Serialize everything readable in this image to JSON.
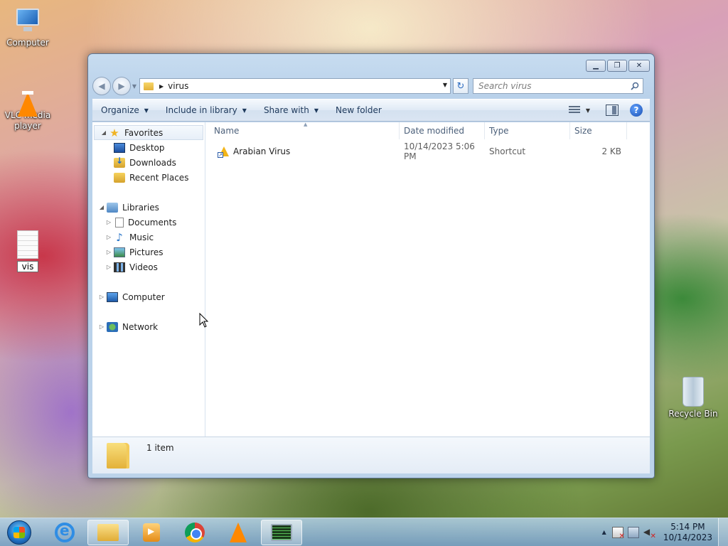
{
  "desktop": {
    "icons": [
      {
        "label": "Computer",
        "icon": "computer-icon"
      },
      {
        "label": "VLC media player",
        "icon": "vlc-icon"
      },
      {
        "label": "vis",
        "icon": "text-file-icon"
      },
      {
        "label": "Recycle Bin",
        "icon": "recycle-bin-icon"
      }
    ]
  },
  "window": {
    "address": {
      "path": "virus"
    },
    "search": {
      "placeholder": "Search virus"
    },
    "toolbar": {
      "organize": "Organize",
      "include_in_library": "Include in library",
      "share_with": "Share with",
      "new_folder": "New folder"
    },
    "nav_pane": {
      "favorites": {
        "label": "Favorites",
        "items": [
          "Desktop",
          "Downloads",
          "Recent Places"
        ]
      },
      "libraries": {
        "label": "Libraries",
        "items": [
          "Documents",
          "Music",
          "Pictures",
          "Videos"
        ]
      },
      "computer": "Computer",
      "network": "Network"
    },
    "columns": {
      "name": "Name",
      "date_modified": "Date modified",
      "type": "Type",
      "size": "Size"
    },
    "files": [
      {
        "name": "Arabian Virus",
        "date_modified": "10/14/2023 5:06 PM",
        "type": "Shortcut",
        "size": "2 KB",
        "icon": "shortcut-icon"
      }
    ],
    "details": {
      "item_count": "1 item"
    }
  },
  "taskbar": {
    "apps": [
      "internet-explorer",
      "windows-explorer",
      "windows-media-player",
      "chrome",
      "vlc",
      "monitor-app"
    ],
    "clock": {
      "time": "5:14 PM",
      "date": "10/14/2023"
    }
  }
}
